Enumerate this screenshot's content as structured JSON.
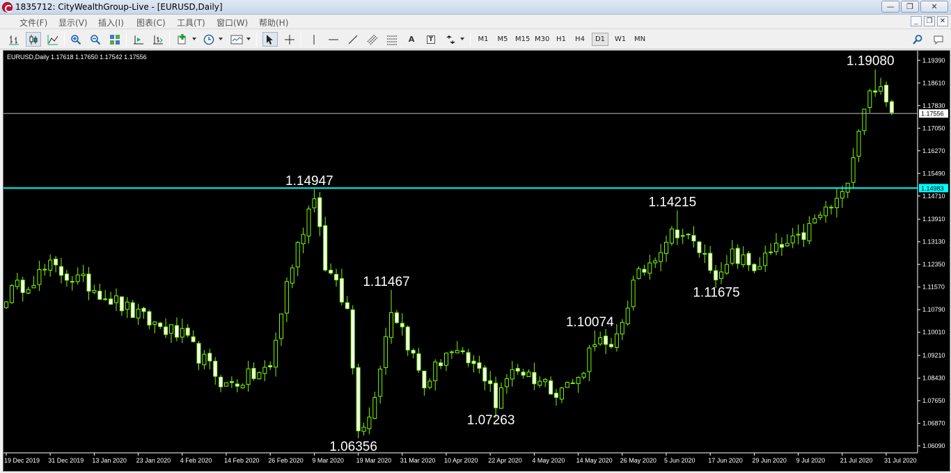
{
  "window": {
    "title": "1835712: CityWealthGroup-Live - [EURUSD,Daily]",
    "controls": [
      "—",
      "❐",
      "✕"
    ],
    "mdi_controls": [
      "_",
      "❐",
      "✕"
    ]
  },
  "menu": [
    "文件(F)",
    "显示(V)",
    "插入(I)",
    "图表(C)",
    "工具(T)",
    "窗口(W)",
    "帮助(H)"
  ],
  "toolbar": {
    "timeframes": [
      "M1",
      "M5",
      "M15",
      "M30",
      "H1",
      "H4",
      "D1",
      "W1",
      "MN"
    ],
    "active_timeframe": "D1",
    "text_tool": "A",
    "text_label_tool": "T"
  },
  "colors": {
    "background": "#000000",
    "candle": "#7CFC00",
    "bull_body": "#000000",
    "bear_body": "#ffffff",
    "horizontal_line": "#00ffff",
    "bid_line": "#c0c0c0",
    "annotation": "#ffffff",
    "axis_text": "#ffffff"
  },
  "chart_data": {
    "type": "candlestick",
    "title": "EURUSD,Daily  1.17618 1.17650 1.17542 1.17556",
    "symbol": "EURUSD",
    "timeframe": "Daily",
    "ohlc_header": [
      "1.17618",
      "1.17650",
      "1.17542",
      "1.17556"
    ],
    "ylim": [
      1.0585,
      1.1972
    ],
    "y_ticks": [
      "1.19390",
      "1.18610",
      "1.17830",
      "1.17050",
      "1.16270",
      "1.15490",
      "1.14710",
      "1.13910",
      "1.13130",
      "1.12350",
      "1.11570",
      "1.10790",
      "1.10010",
      "1.09210",
      "1.08430",
      "1.07650",
      "1.06870",
      "1.06090"
    ],
    "x_ticks": [
      "19 Dec 2019",
      "31 Dec 2019",
      "13 Jan 2020",
      "23 Jan 2020",
      "4 Feb 2020",
      "14 Feb 2020",
      "26 Feb 2020",
      "9 Mar 2020",
      "19 Mar 2020",
      "31 Mar 2020",
      "10 Apr 2020",
      "22 Apr 2020",
      "4 May 2020",
      "14 May 2020",
      "26 May 2020",
      "5 Jun 2020",
      "17 Jun 2020",
      "29 Jun 2020",
      "9 Jul 2020",
      "21 Jul 2020",
      "31 Jul 2020"
    ],
    "x_tick_bar_index": [
      0,
      8,
      16,
      24,
      32,
      40,
      48,
      56,
      64,
      72,
      80,
      88,
      96,
      104,
      112,
      120,
      128,
      136,
      144,
      152,
      160
    ],
    "price_labels": [
      {
        "value": "1.17556",
        "price": 1.17556,
        "style": "bid"
      },
      {
        "value": "1.14983",
        "price": 1.14983,
        "style": "line"
      }
    ],
    "horizontal_lines": [
      {
        "price": 1.17556,
        "kind": "bid"
      },
      {
        "price": 1.14983,
        "kind": "level"
      }
    ],
    "annotations": [
      {
        "text": "1.14947",
        "bar": 56,
        "price": 1.14947,
        "pos": "above"
      },
      {
        "text": "1.06356",
        "bar": 64,
        "price": 1.06356,
        "pos": "below"
      },
      {
        "text": "1.11467",
        "bar": 70,
        "price": 1.11467,
        "pos": "above"
      },
      {
        "text": "1.07263",
        "bar": 89,
        "price": 1.07263,
        "pos": "below"
      },
      {
        "text": "1.10074",
        "bar": 107,
        "price": 1.10074,
        "pos": "above"
      },
      {
        "text": "1.14215",
        "bar": 122,
        "price": 1.14215,
        "pos": "above"
      },
      {
        "text": "1.11675",
        "bar": 130,
        "price": 1.11675,
        "pos": "below"
      },
      {
        "text": "1.19080",
        "bar": 158,
        "price": 1.1908,
        "pos": "above"
      }
    ],
    "x_key": [
      [
        0,
        1.113
      ],
      [
        8,
        1.1225
      ],
      [
        16,
        1.1155
      ],
      [
        24,
        1.1055
      ],
      [
        32,
        1.0985
      ],
      [
        40,
        1.0815
      ],
      [
        48,
        1.0875
      ],
      [
        51,
        1.117
      ],
      [
        56,
        1.1488
      ],
      [
        58,
        1.1235
      ],
      [
        62,
        1.1075
      ],
      [
        64,
        1.0685
      ],
      [
        66,
        1.0705
      ],
      [
        70,
        1.1085
      ],
      [
        72,
        1.1015
      ],
      [
        76,
        1.0815
      ],
      [
        80,
        1.0935
      ],
      [
        84,
        1.0895
      ],
      [
        88,
        1.0835
      ],
      [
        89,
        1.0745
      ],
      [
        92,
        1.0885
      ],
      [
        96,
        1.0845
      ],
      [
        100,
        1.0805
      ],
      [
        104,
        1.0835
      ],
      [
        107,
        1.0985
      ],
      [
        110,
        1.0925
      ],
      [
        114,
        1.1165
      ],
      [
        120,
        1.1325
      ],
      [
        122,
        1.1355
      ],
      [
        126,
        1.1285
      ],
      [
        130,
        1.1185
      ],
      [
        132,
        1.1265
      ],
      [
        136,
        1.1225
      ],
      [
        140,
        1.1285
      ],
      [
        144,
        1.1315
      ],
      [
        148,
        1.1405
      ],
      [
        152,
        1.1465
      ],
      [
        156,
        1.1785
      ],
      [
        158,
        1.1855
      ],
      [
        161,
        1.1756
      ]
    ],
    "bars": 162
  }
}
